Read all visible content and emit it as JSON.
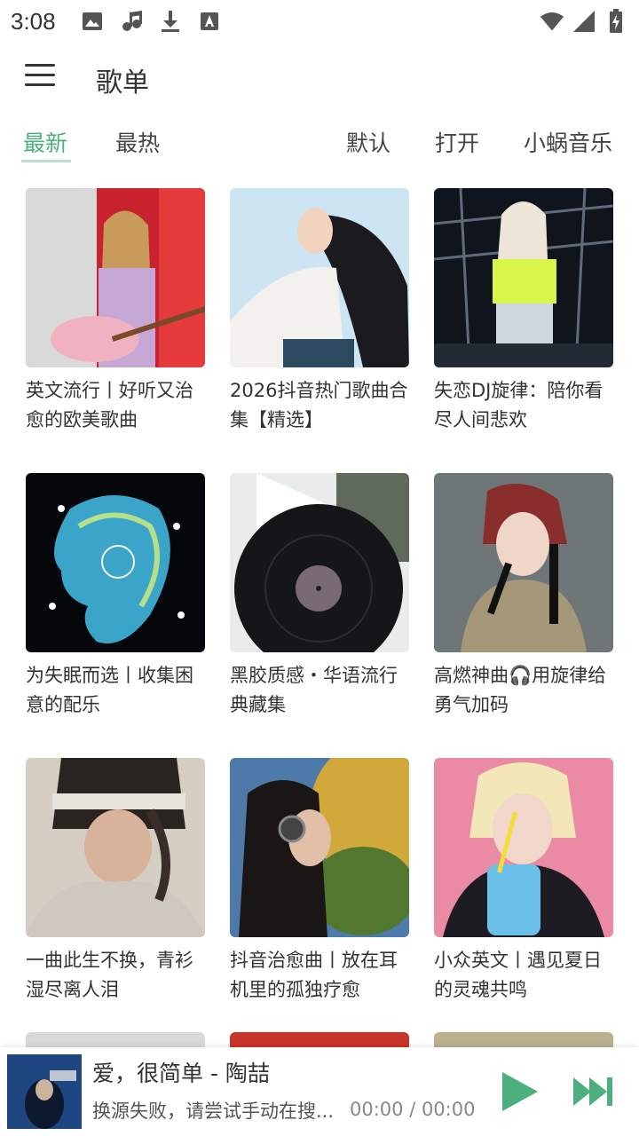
{
  "status_bar": {
    "time": "3:08",
    "left_icons": [
      "image-icon",
      "music-icon",
      "download-icon",
      "text-icon"
    ],
    "right_icons": [
      "wifi-icon",
      "signal-icon",
      "battery-icon"
    ]
  },
  "app_bar": {
    "title": "歌单",
    "menu_icon": "hamburger-menu-icon"
  },
  "tabs": {
    "left": [
      {
        "label": "最新",
        "active": true
      },
      {
        "label": "最热",
        "active": false
      }
    ],
    "right": [
      {
        "label": "默认"
      },
      {
        "label": "打开"
      },
      {
        "label": "小蜗音乐"
      }
    ],
    "accent_color": "#4caf7d"
  },
  "playlists": [
    {
      "title": "英文流行丨好听又治愈的欧美歌曲"
    },
    {
      "title": "2026抖音热门歌曲合集【精选】"
    },
    {
      "title": "失恋DJ旋律：陪你看尽人间悲欢"
    },
    {
      "title": "为失眠而选丨收集困意的配乐"
    },
    {
      "title": "黑胶质感・华语流行典藏集"
    },
    {
      "title": "高燃神曲🎧用旋律给勇气加码"
    },
    {
      "title": "一曲此生不换，青衫湿尽离人泪"
    },
    {
      "title": "抖音治愈曲丨放在耳机里的孤独疗愈"
    },
    {
      "title": "小众英文丨遇见夏日的灵魂共鸣"
    }
  ],
  "player": {
    "song": "爱，很简单 - 陶喆",
    "status": "换源失败，请尝试手动在搜...",
    "time": "00:00 / 00:00",
    "play_icon": "play-icon",
    "next_icon": "skip-next-icon",
    "accent_color": "#4caf7d"
  }
}
